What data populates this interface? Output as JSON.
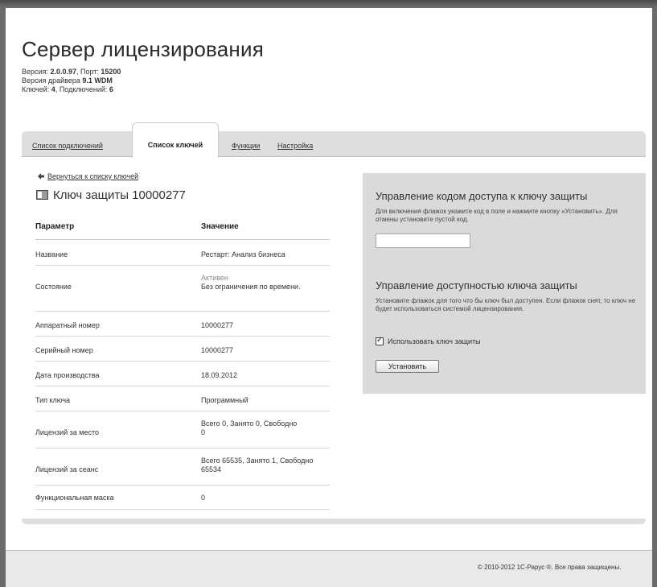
{
  "header": {
    "title": "Сервер лицензирования",
    "version_label": "Версия:",
    "version_value": "2.0.0.97",
    "port_label": ", Порт:",
    "port_value": "15200",
    "driver_label": "Версия драйвера",
    "driver_value": "9.1 WDM",
    "keys_label": "Ключей:",
    "keys_value": "4",
    "connections_label": ", Подключений:",
    "connections_value": "6"
  },
  "tabs": [
    {
      "label": "Список подключений",
      "active": false
    },
    {
      "label": "Список ключей",
      "active": true
    },
    {
      "label": "Функции",
      "active": false
    },
    {
      "label": "Настройка",
      "active": false
    }
  ],
  "key_view": {
    "back_link": "Вернуться к списку ключей",
    "title": "Ключ защиты 10000277",
    "table": {
      "col_param": "Параметр",
      "col_value": "Значение",
      "rows": [
        {
          "param": "Название",
          "value": "Рестарт: Анализ бизнеса"
        },
        {
          "param": "Состояние",
          "value_muted": "Активен",
          "value": "Без ограничения по времени."
        },
        {
          "param": "Аппаратный номер",
          "value": "10000277"
        },
        {
          "param": "Серийный номер",
          "value": "10000277"
        },
        {
          "param": "Дата производства",
          "value": "18.09.2012"
        },
        {
          "param": "Тип ключа",
          "value": "Программный"
        },
        {
          "param": "Лицензий за место",
          "value": "Всего 0, Занято 0, Свободно 0"
        },
        {
          "param": "Лицензий за сеанс",
          "value": "Всего 65535, Занято 1, Свободно 65534"
        },
        {
          "param": "Функциональная маска",
          "value": "0"
        }
      ]
    }
  },
  "access_code": {
    "title": "Управление кодом доступа к ключу защиты",
    "description": "Для включения флажок укажите код в поле и нажмите кнопку «Установить». Для отмены установите пустой код.",
    "input_value": ""
  },
  "availability": {
    "title": "Управление доступностью ключа защиты",
    "description": "Установите флажок для того что бы ключ был доступен. Если флажок снят, то ключ не будет использоваться системой лицензирования.",
    "checkbox_label": "Использовать ключ защиты",
    "checkbox_checked": true,
    "button_label": "Установить"
  },
  "footer": {
    "copyright": "© 2010-2012 1С-Рарус ®. Все права защищены."
  }
}
